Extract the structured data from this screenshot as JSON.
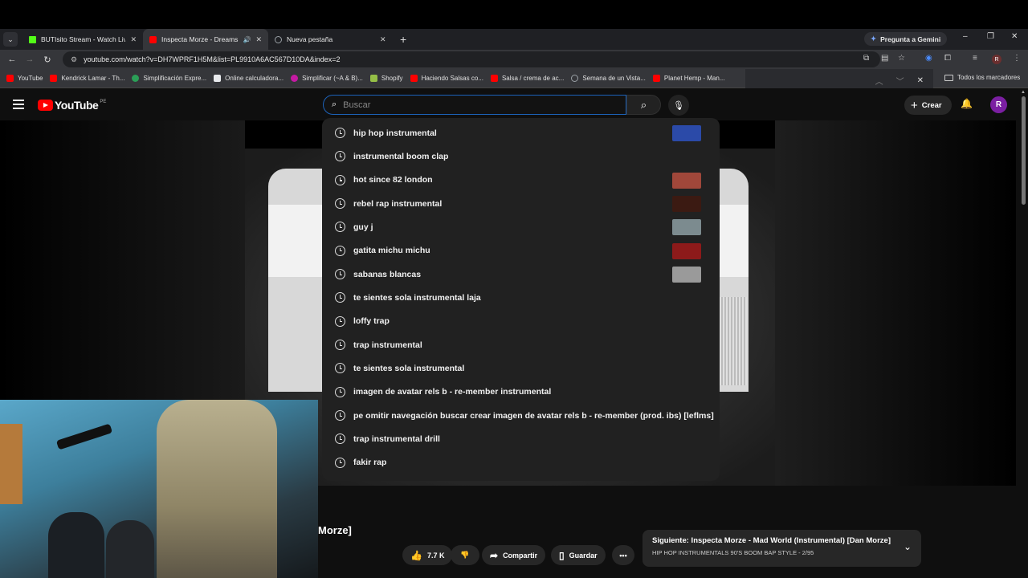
{
  "tabs": [
    {
      "title": "BUTIsito Stream - Watch Live o",
      "fav_color": "#53fc18"
    },
    {
      "title": "Inspecta Morze - Dreams (I",
      "fav_color": "#ff0000",
      "active": true
    },
    {
      "title": "Nueva pestaña",
      "fav_color": "#9aa0a6"
    }
  ],
  "gemini_label": "Pregunta a Gemini",
  "url": "youtube.com/watch?v=DH7WPRF1H5M&list=PL9910A6AC567D10DA&index=2",
  "profile_initial": "R",
  "bookmarks": [
    {
      "label": "YouTube",
      "color": "#ff0000"
    },
    {
      "label": "Kendrick Lamar - Th...",
      "color": "#ff0000"
    },
    {
      "label": "Simplificación Expre...",
      "color": "#2b9f57"
    },
    {
      "label": "Online calculadora...",
      "color": "#e8eaed"
    },
    {
      "label": "Simplificar (~A & B)...",
      "color": "#c51aa3"
    },
    {
      "label": "Shopify",
      "color": "#95bf47"
    },
    {
      "label": "Haciendo Salsas co...",
      "color": "#ff0000"
    },
    {
      "label": "Salsa / crema de ac...",
      "color": "#ff0000"
    },
    {
      "label": "Semana de un Vista...",
      "color": "#9aa0a6"
    },
    {
      "label": "Planet Hemp - Man...",
      "color": "#ff0000"
    }
  ],
  "all_bookmarks": "Todos los marcadores",
  "youtube": {
    "logo_text": "YouTube",
    "country": "PE",
    "search_placeholder": "Buscar",
    "create_label": "Crear",
    "avatar_initial": "R"
  },
  "suggestions": [
    {
      "text": "hip hop instrumental",
      "thumb": "#2b4aa8"
    },
    {
      "text": "instrumental boom clap",
      "thumb": null
    },
    {
      "text": "hot since 82 london",
      "thumb": "#a0473a"
    },
    {
      "text": "rebel rap instrumental",
      "thumb": "#3b1a12"
    },
    {
      "text": "guy j",
      "thumb": "#7c8b8f"
    },
    {
      "text": "gatita michu michu",
      "thumb": "#8d1a1a"
    },
    {
      "text": "sabanas blancas",
      "thumb": "#9a9a9a"
    },
    {
      "text": "te sientes sola instrumental laja",
      "thumb": null
    },
    {
      "text": "loffy trap",
      "thumb": null
    },
    {
      "text": "trap instrumental",
      "thumb": null
    },
    {
      "text": "te sientes sola instrumental",
      "thumb": null
    },
    {
      "text": "imagen de avatar rels b - re-member instrumental",
      "thumb": null
    },
    {
      "text": "pe omitir navegación buscar crear imagen de avatar rels b - re-member (prod. ibs) [leflms]",
      "thumb": null
    },
    {
      "text": "trap instrumental drill",
      "thumb": null
    },
    {
      "text": "fakir rap",
      "thumb": null
    }
  ],
  "video": {
    "title_fragment": "Morze]",
    "likes": "7.7 K",
    "share_label": "Compartir",
    "save_label": "Guardar"
  },
  "next_up": {
    "line1": "Siguiente: Inspecta Morze - Mad World (Instrumental) [Dan Morze]",
    "line2": "HIP HOP INSTRUMENTALS 90'S BOOM BAP STYLE - 2/95"
  }
}
